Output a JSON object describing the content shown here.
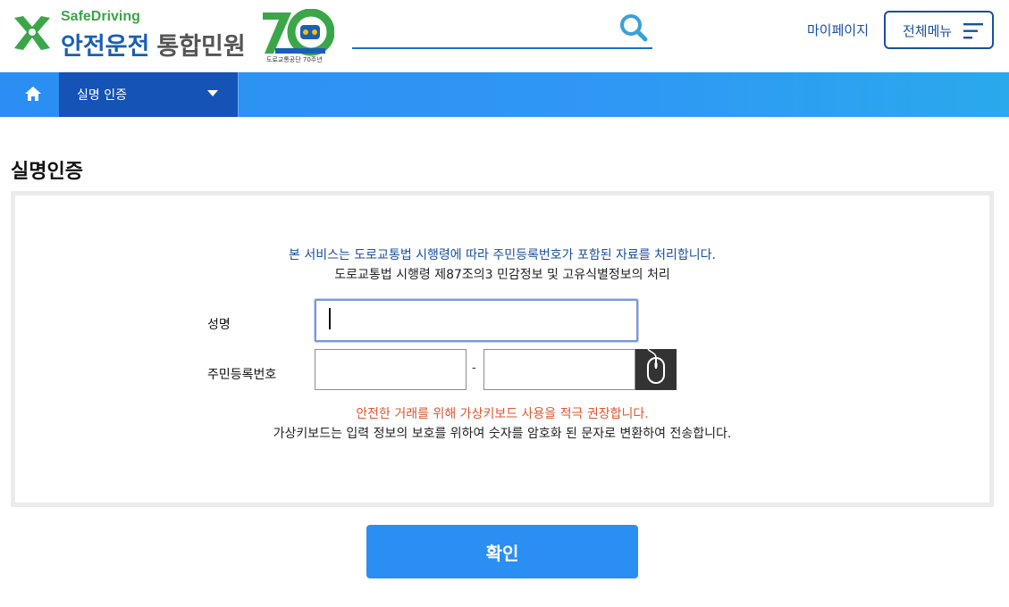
{
  "header": {
    "logo_sub": "SafeDriving",
    "logo_main_blue": "안전운전",
    "logo_main_gray": "통합민원",
    "logo_70_caption": "도로교통공단 70주년",
    "search": {
      "value": "",
      "placeholder": ""
    },
    "mypage_label": "마이페이지",
    "allmenu_label": "전체메뉴"
  },
  "nav": {
    "home_icon": "home-icon",
    "current_menu": "실명 인증"
  },
  "main": {
    "page_title": "실명인증",
    "notice_line1": "본 서비스는 도로교통법 시행령에 따라 주민등록번호가 포함된 자료를 처리합니다.",
    "notice_line2": "도로교통법 시행령 제87조의3 민감정보 및 고유식별정보의 처리",
    "form": {
      "name_label": "성명",
      "name_value": "",
      "rrn_label": "주민등록번호",
      "rrn_front_value": "",
      "rrn_separator": "-",
      "rrn_back_value": "",
      "virtual_keyboard_icon": "mouse-icon"
    },
    "warning_line1": "안전한 거래를 위해 가상키보드 사용을 적극 권장합니다.",
    "warning_line2": "가상키보드는 입력 정보의 보호를 위하여 숫자를 암호화 된 문자로 변환하여 전송합니다.",
    "confirm_label": "확인"
  },
  "colors": {
    "brand_blue": "#1a4fa0",
    "nav_blue": "#2a8ef2",
    "nav_dark": "#1553b6",
    "warning_red": "#e0552e",
    "logo_green": "#3aa648"
  }
}
